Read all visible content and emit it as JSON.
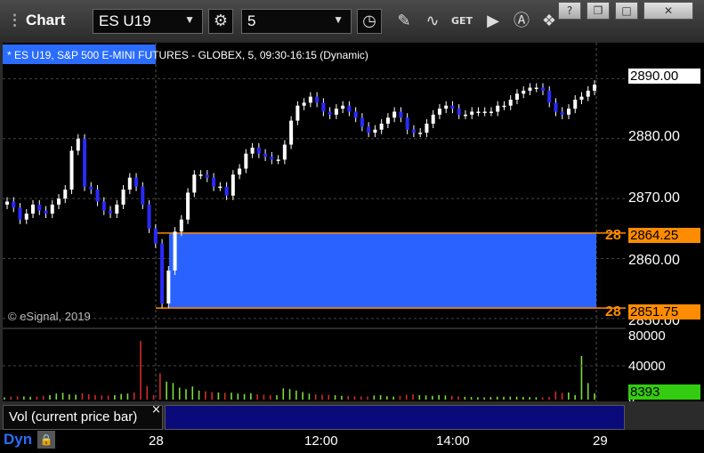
{
  "window": {
    "title": "Chart",
    "symbol": "ES U19",
    "interval": "5",
    "get_label": "GET",
    "minimize": "?",
    "restore": "❐",
    "maximize": "□",
    "close": "✕"
  },
  "toolbar_icons": [
    "gear-icon",
    "clock-icon",
    "pencil-icon",
    "study-icon",
    "get-icon",
    "play-icon",
    "alert-icon",
    "dock-icon"
  ],
  "chart_info": "* ES U19, S&P 500 E-MINI FUTURES - GLOBEX, 5, 09:30-16:15 (Dynamic)",
  "copyright": "© eSignal, 2019",
  "price_axis": {
    "ticks": [
      "2890.00",
      "2880.00",
      "2870.00",
      "2860.00",
      "2850.00"
    ],
    "last_price": "2890.00",
    "zone_top": "2864.25",
    "zone_bottom": "2851.75",
    "zone_top_label": "28",
    "zone_bottom_label": "28"
  },
  "volume_axis": {
    "ticks": [
      "80000",
      "40000",
      "0"
    ],
    "current": "8393"
  },
  "volume_legend": "Vol (current price bar)",
  "volume_legend_close": "×",
  "time_axis": [
    "28",
    "12:00",
    "14:00",
    "29"
  ],
  "status": {
    "mode": "Dyn",
    "lock": "🔒"
  },
  "colors": {
    "up": "#ffffff",
    "down": "#2a2aff",
    "zone": "#2a62ff",
    "zone_line": "#ff8c00",
    "vol_up": "#7ddc3a",
    "vol_down": "#d42a2a",
    "last_bg": "#33cc11"
  },
  "chart_data": {
    "type": "candlestick",
    "title": "* ES U19, S&P 500 E-MINI FUTURES - GLOBEX, 5, 09:30-16:15 (Dynamic)",
    "ylim": [
      2848.5,
      2896
    ],
    "zone": [
      2851.75,
      2864.25
    ],
    "last": 2890.0,
    "session_end_index": 82,
    "close": [
      2869.5,
      2868.5,
      2866.5,
      2867.5,
      2869.0,
      2868.0,
      2867.5,
      2869.0,
      2870.0,
      2871.5,
      2878.0,
      2880.0,
      2872.0,
      2871.5,
      2869.5,
      2868.0,
      2867.5,
      2869.0,
      2871.5,
      2873.5,
      2872.0,
      2869.0,
      2865.0,
      2862.5,
      2852.5,
      2858.0,
      2864.5,
      2866.5,
      2871.0,
      2874.0,
      2874.0,
      2873.5,
      2872.0,
      2872.0,
      2870.5,
      2874.0,
      2875.0,
      2877.5,
      2878.5,
      2877.5,
      2877.0,
      2876.5,
      2876.5,
      2879.0,
      2883.0,
      2885.5,
      2886.0,
      2887.0,
      2886.0,
      2884.5,
      2884.0,
      2885.0,
      2885.5,
      2884.5,
      2883.5,
      2882.0,
      2881.0,
      2881.5,
      2882.5,
      2883.5,
      2884.5,
      2883.5,
      2881.5,
      2881.0,
      2881.0,
      2882.5,
      2884.0,
      2885.0,
      2885.5,
      2885.0,
      2884.0,
      2884.0,
      2884.5,
      2884.5,
      2884.5,
      2884.5,
      2885.5,
      2885.5,
      2886.5,
      2887.5,
      2888.0,
      2888.5,
      2888.5,
      2888.0,
      2886.0,
      2884.5,
      2884.0,
      2885.0,
      2886.5,
      2887.0,
      2888.0,
      2889.0
    ],
    "volume": [
      3000,
      4000,
      4500,
      4200,
      3800,
      4100,
      5000,
      6000,
      8000,
      9000,
      7000,
      6500,
      8500,
      7000,
      6000,
      5500,
      5200,
      6000,
      7500,
      8000,
      9500,
      78000,
      18000,
      6000,
      35000,
      24000,
      22000,
      16000,
      14000,
      17500,
      12000,
      11000,
      10000,
      9500,
      9000,
      9200,
      8000,
      7500,
      8500,
      7000,
      6500,
      6000,
      5800,
      15000,
      14000,
      12000,
      10000,
      8000,
      7000,
      6500,
      6200,
      5800,
      5000,
      4800,
      4500,
      4200,
      4000,
      5500,
      6000,
      4500,
      4000,
      5000,
      6500,
      7000,
      6000,
      5500,
      5000,
      6000,
      5500,
      4800,
      4200,
      3800,
      3500,
      3200,
      3000,
      3500,
      4000,
      3800,
      4000,
      3900,
      3600,
      3400,
      3200,
      3000,
      3500,
      11000,
      9000,
      9500,
      6000,
      58000,
      22000,
      8393
    ]
  }
}
